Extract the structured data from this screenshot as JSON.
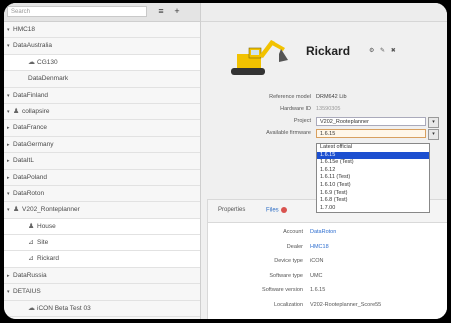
{
  "sidebar": {
    "search_placeholder": "Search",
    "toolbar": {
      "menu_icon": "≡",
      "add_icon": "+"
    },
    "items": [
      {
        "label": "HMC18",
        "twisty": "▾",
        "icon": ""
      },
      {
        "label": "DataAustralia",
        "twisty": "▾",
        "icon": ""
      },
      {
        "label": "CG130",
        "twisty": "",
        "icon": "☁"
      },
      {
        "label": "DataDenmark",
        "twisty": "",
        "icon": ""
      },
      {
        "label": "DataFinland",
        "twisty": "▾",
        "icon": ""
      },
      {
        "label": "collapsire",
        "twisty": "▾",
        "icon": "♟"
      },
      {
        "label": "DataFrance",
        "twisty": "▸",
        "icon": ""
      },
      {
        "label": "DataGermany",
        "twisty": "▸",
        "icon": ""
      },
      {
        "label": "DataItL",
        "twisty": "▸",
        "icon": ""
      },
      {
        "label": "DataPoland",
        "twisty": "▸",
        "icon": ""
      },
      {
        "label": "DataRoton",
        "twisty": "▾",
        "icon": ""
      },
      {
        "label": "V202_Ronteplanner",
        "twisty": "▾",
        "icon": "♟"
      },
      {
        "label": "House",
        "twisty": "",
        "icon": "♟"
      },
      {
        "label": "Site",
        "twisty": "",
        "icon": "⊿"
      },
      {
        "label": "Rickard",
        "twisty": "",
        "icon": "⊿"
      },
      {
        "label": "DataRussia",
        "twisty": "▸",
        "icon": ""
      },
      {
        "label": "DETAIUS",
        "twisty": "▾",
        "icon": ""
      },
      {
        "label": "iCON Beta Test 03",
        "twisty": "",
        "icon": "☁"
      },
      {
        "label": "iCON Beta Test 04",
        "twisty": "",
        "icon": "⊿"
      }
    ]
  },
  "machine": {
    "name": "Rickard",
    "title_icons": "⚙ ✎ ✖",
    "fields": [
      {
        "label": "Reference model",
        "value": "DRM642 Lib"
      },
      {
        "label": "Hardware ID",
        "value": "13590305"
      },
      {
        "label": "Project",
        "value": "V202_Rooteplanner"
      },
      {
        "label": "Available firmware",
        "value": "1.6.15"
      }
    ],
    "firmware_options": [
      "Latest official",
      "1.6.15",
      "1.6.15e (Test)",
      "1.6.12",
      "1.6.11 (Test)",
      "1.6.10 (Test)",
      "1.6.9 (Test)",
      "1.6.8 (Test)",
      "1.7.00"
    ],
    "firmware_highlighted": "1.6.15"
  },
  "tabs": {
    "items": [
      "Properties",
      "Files"
    ],
    "active": "Files"
  },
  "details": [
    {
      "label": "Account",
      "value": "DataRoton",
      "link": true
    },
    {
      "label": "Dealer",
      "value": "HMC18",
      "link": true
    },
    {
      "label": "Device type",
      "value": "iCON"
    },
    {
      "label": "Software type",
      "value": "UMC"
    },
    {
      "label": "Software version",
      "value": "1.6.15"
    },
    {
      "label": "Localization",
      "value": "V202-Rooteplanner_Score55"
    }
  ],
  "colors": {
    "accent": "#2b6cc4",
    "highlight": "#1c4fd0",
    "machine_yellow": "#f2c200"
  }
}
